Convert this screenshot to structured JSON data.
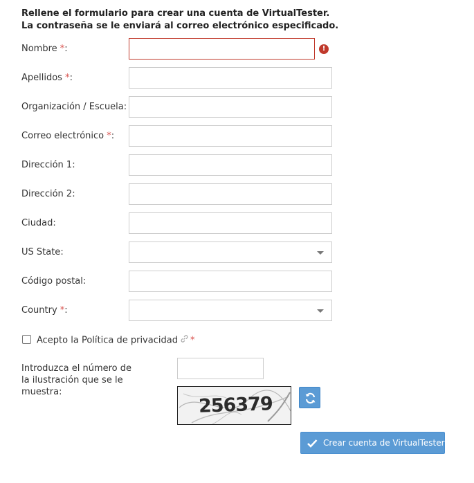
{
  "intro": "Rellene el formulario para crear una cuenta de VirtualTester. La contraseña se le enviará al correo electrónico especificado.",
  "required_mark": "*",
  "label_suffix": ":",
  "fields": {
    "nombre": {
      "label": "Nombre",
      "value": ""
    },
    "apellidos": {
      "label": "Apellidos",
      "value": ""
    },
    "organizacion": {
      "label": "Organización / Escuela",
      "value": ""
    },
    "correo": {
      "label": "Correo electrónico",
      "value": ""
    },
    "direccion1": {
      "label": "Dirección 1",
      "value": ""
    },
    "direccion2": {
      "label": "Dirección 2",
      "value": ""
    },
    "ciudad": {
      "label": "Ciudad",
      "value": ""
    },
    "us_state": {
      "label": "US State",
      "value": ""
    },
    "codigo_postal": {
      "label": "Código postal",
      "value": ""
    },
    "country": {
      "label": "Country",
      "value": ""
    }
  },
  "error_icon": {
    "icon": "exclamation-circle-icon",
    "glyph": "!",
    "color": "#c0392b"
  },
  "privacy": {
    "label": "Acepto la Política de privacidad",
    "checked": false,
    "icon": "link-icon"
  },
  "captcha": {
    "label": "Introduzca el número de la ilustración que se le muestra:",
    "value": "",
    "image_text": "256379",
    "refresh_icon": "refresh-icon"
  },
  "submit": {
    "label": "Crear cuenta de VirtualTester",
    "icon": "check-icon"
  },
  "colors": {
    "accent": "#5b9bd5",
    "error": "#c0392b",
    "required": "#d9534f",
    "border": "#cccccc"
  }
}
